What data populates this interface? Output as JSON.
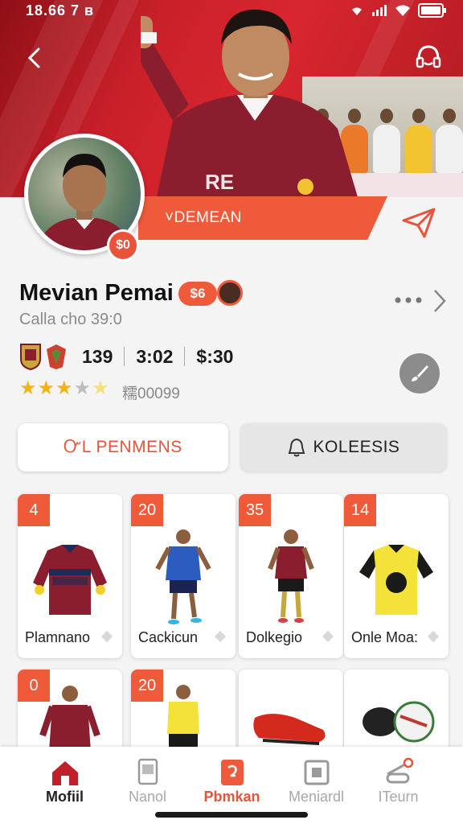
{
  "status_bar": {
    "time": "18.66 7 ʙ"
  },
  "header": {
    "strip_label": "˅DEMEAN",
    "avatar_badge": "$0"
  },
  "profile": {
    "name": "Mevian Pemai",
    "name_badge": "$6",
    "subtitle": "Calla cho 39:0",
    "stats": [
      "139",
      "3:02",
      "$:30"
    ],
    "rating_stars": 3.5,
    "rating_text": "糯00099"
  },
  "tabs": [
    {
      "label": "ᏅL PENMENS",
      "active": true
    },
    {
      "label": "KOLEESIS",
      "active": false
    }
  ],
  "grid": [
    {
      "num": "4",
      "label": "Plamnano",
      "icon": "jersey-icon"
    },
    {
      "num": "20",
      "label": "Cackicun",
      "icon": "player-icon"
    },
    {
      "num": "35",
      "label": "Dolkegio",
      "icon": "player-icon"
    },
    {
      "num": "14",
      "label": "Onle Moa:",
      "icon": "jersey-icon"
    },
    {
      "num": "0",
      "label": "",
      "icon": "player-icon"
    },
    {
      "num": "20",
      "label": "",
      "icon": "player-icon"
    },
    {
      "num": "",
      "label": "",
      "icon": "boot-icon"
    },
    {
      "num": "",
      "label": "",
      "icon": "ball-icon"
    }
  ],
  "nav": [
    {
      "label": "Mofiil",
      "icon": "home-icon"
    },
    {
      "label": "Nanol",
      "icon": "device-icon"
    },
    {
      "label": "Pbmkan",
      "icon": "collection-icon"
    },
    {
      "label": "Meniardl",
      "icon": "store-icon"
    },
    {
      "label": "ITeurn",
      "icon": "profile-icon"
    }
  ],
  "colors": {
    "accent": "#ef5b3a",
    "hero_red": "#c9202a",
    "jersey": "#8a1d2e"
  }
}
